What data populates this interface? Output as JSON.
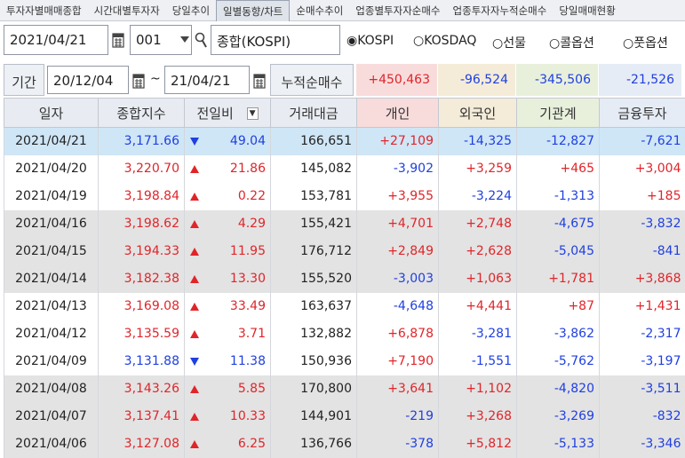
{
  "tabs": [
    "투자자별매매종합",
    "시간대별투자자",
    "당일추이",
    "일별동향/차트",
    "순매수추이",
    "업종별투자자순매수",
    "업종투자자누적순매수",
    "당일매매현황"
  ],
  "active_tab_index": 3,
  "controls": {
    "date": "2021/04/21",
    "code": "001",
    "market_name": "종합(KOSPI)",
    "radios": [
      "KOSPI",
      "KOSDAQ",
      "선물",
      "콜옵션",
      "풋옵션"
    ],
    "selected_radio": "KOSPI"
  },
  "period": {
    "label": "기간",
    "from": "20/12/04",
    "tilde": "~",
    "to": "21/04/21",
    "cum_label": "누적순매수",
    "sums": [
      "+450,463",
      "-96,524",
      "-345,506",
      "-21,526"
    ]
  },
  "table": {
    "headers": [
      "일자",
      "종합지수",
      "전일비",
      "거래대금",
      "개인",
      "외국인",
      "기관계",
      "금융투자"
    ],
    "rows": [
      {
        "date": "2021/04/21",
        "index": "3,171.66",
        "dir": "down",
        "change": "49.04",
        "volume": "166,651",
        "indiv": "+27,109",
        "foreign": "-14,325",
        "inst": "-12,827",
        "fin": "-7,621",
        "style": "sel"
      },
      {
        "date": "2021/04/20",
        "index": "3,220.70",
        "dir": "up",
        "change": "21.86",
        "volume": "145,082",
        "indiv": "-3,902",
        "foreign": "+3,259",
        "inst": "+465",
        "fin": "+3,004",
        "style": "white"
      },
      {
        "date": "2021/04/19",
        "index": "3,198.84",
        "dir": "up",
        "change": "0.22",
        "volume": "153,781",
        "indiv": "+3,955",
        "foreign": "-3,224",
        "inst": "-1,313",
        "fin": "+185",
        "style": "white"
      },
      {
        "date": "2021/04/16",
        "index": "3,198.62",
        "dir": "up",
        "change": "4.29",
        "volume": "155,421",
        "indiv": "+4,701",
        "foreign": "+2,748",
        "inst": "-4,675",
        "fin": "-3,832",
        "style": "gray"
      },
      {
        "date": "2021/04/15",
        "index": "3,194.33",
        "dir": "up",
        "change": "11.95",
        "volume": "176,712",
        "indiv": "+2,849",
        "foreign": "+2,628",
        "inst": "-5,045",
        "fin": "-841",
        "style": "gray"
      },
      {
        "date": "2021/04/14",
        "index": "3,182.38",
        "dir": "up",
        "change": "13.30",
        "volume": "155,520",
        "indiv": "-3,003",
        "foreign": "+1,063",
        "inst": "+1,781",
        "fin": "+3,868",
        "style": "gray"
      },
      {
        "date": "2021/04/13",
        "index": "3,169.08",
        "dir": "up",
        "change": "33.49",
        "volume": "163,637",
        "indiv": "-4,648",
        "foreign": "+4,441",
        "inst": "+87",
        "fin": "+1,431",
        "style": "white"
      },
      {
        "date": "2021/04/12",
        "index": "3,135.59",
        "dir": "up",
        "change": "3.71",
        "volume": "132,882",
        "indiv": "+6,878",
        "foreign": "-3,281",
        "inst": "-3,862",
        "fin": "-2,317",
        "style": "white"
      },
      {
        "date": "2021/04/09",
        "index": "3,131.88",
        "dir": "down",
        "change": "11.38",
        "volume": "150,936",
        "indiv": "+7,190",
        "foreign": "-1,551",
        "inst": "-5,762",
        "fin": "-3,197",
        "style": "white"
      },
      {
        "date": "2021/04/08",
        "index": "3,143.26",
        "dir": "up",
        "change": "5.85",
        "volume": "170,800",
        "indiv": "+3,641",
        "foreign": "+1,102",
        "inst": "-4,820",
        "fin": "-3,511",
        "style": "gray"
      },
      {
        "date": "2021/04/07",
        "index": "3,137.41",
        "dir": "up",
        "change": "10.33",
        "volume": "144,901",
        "indiv": "-219",
        "foreign": "+3,268",
        "inst": "-3,269",
        "fin": "-832",
        "style": "gray"
      },
      {
        "date": "2021/04/06",
        "index": "3,127.08",
        "dir": "up",
        "change": "6.25",
        "volume": "136,766",
        "indiv": "-378",
        "foreign": "+5,812",
        "inst": "-5,133",
        "fin": "-3,346",
        "style": "gray"
      }
    ]
  },
  "colors": {
    "up": "#e0252a",
    "down": "#1f3fe0",
    "indiv_bg": "#f8dcdc",
    "foreign_bg": "#f4ecd8",
    "inst_bg": "#e8f0dc",
    "fin_bg": "#e6ecf5",
    "selected_row": "#cfe6f6"
  }
}
